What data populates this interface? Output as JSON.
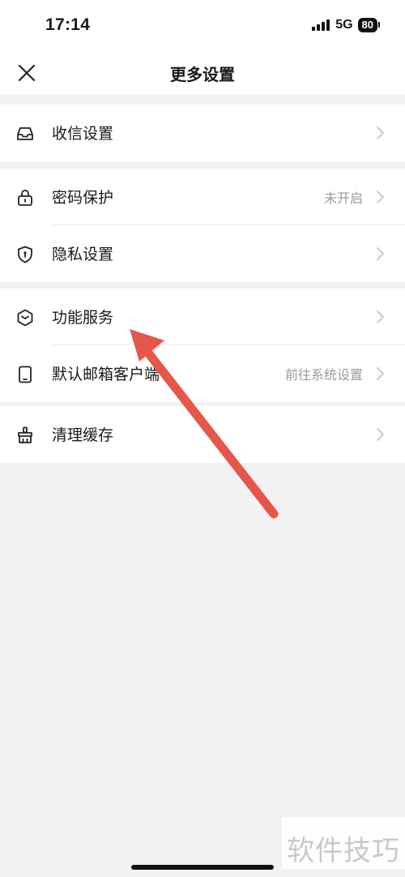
{
  "status_bar": {
    "time": "17:14",
    "network": "5G",
    "battery": "80"
  },
  "nav": {
    "title": "更多设置",
    "close_icon": "close-icon"
  },
  "settings": {
    "inbox": {
      "label": "收信设置",
      "icon": "inbox-icon"
    },
    "password": {
      "label": "密码保护",
      "value": "未开启",
      "icon": "lock-icon"
    },
    "privacy": {
      "label": "隐私设置",
      "icon": "shield-icon"
    },
    "features": {
      "label": "功能服务",
      "icon": "box-icon"
    },
    "default_client": {
      "label": "默认邮箱客户端",
      "value": "前往系统设置",
      "icon": "phone-icon"
    },
    "clear_cache": {
      "label": "清理缓存",
      "icon": "broom-icon"
    }
  },
  "annotation": {
    "arrow_color": "#e4574a",
    "arrow_icon": "pointer-arrow"
  },
  "watermark": "软件技巧"
}
